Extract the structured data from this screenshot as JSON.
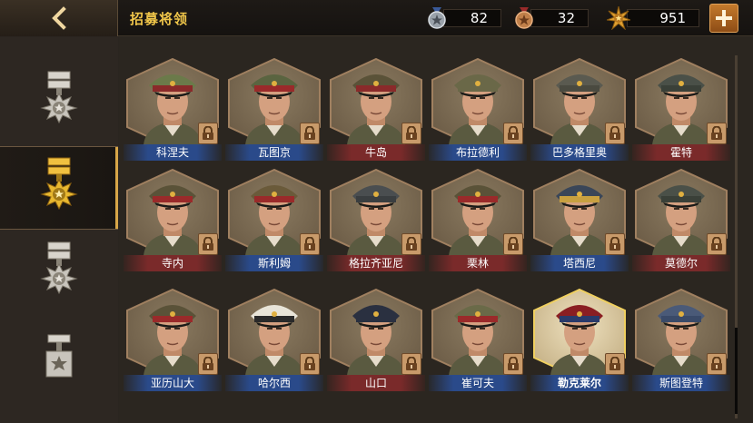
{
  "header": {
    "title": "招募将领",
    "resources": [
      {
        "icon": "silver-medal-icon",
        "value": "82"
      },
      {
        "icon": "bronze-medal-icon",
        "value": "32"
      },
      {
        "icon": "gold-star-badge-icon",
        "value": "951"
      }
    ]
  },
  "sidebar": {
    "tabs": [
      {
        "icon": "rank-1-insignia-icon",
        "active": false
      },
      {
        "icon": "rank-2-insignia-icon",
        "active": true
      },
      {
        "icon": "rank-3-insignia-icon",
        "active": false
      },
      {
        "icon": "rank-4-insignia-icon",
        "active": false
      }
    ]
  },
  "generals": [
    {
      "name": "科涅夫",
      "faction": "blue",
      "cap": "#6b7a4a",
      "band": "#8a2a2a"
    },
    {
      "name": "瓦图京",
      "faction": "blue",
      "cap": "#5a6440",
      "band": "#9a2a2a"
    },
    {
      "name": "牛岛",
      "faction": "red",
      "cap": "#5a5238",
      "band": "#8a2a2a"
    },
    {
      "name": "布拉德利",
      "faction": "blue",
      "cap": "#6a6848",
      "band": "#6a6848"
    },
    {
      "name": "巴多格里奥",
      "faction": "blue",
      "cap": "#5a5a50",
      "band": "#4a4a40"
    },
    {
      "name": "霍特",
      "faction": "red",
      "cap": "#4a5048",
      "band": "#3a4038"
    },
    {
      "name": "寺内",
      "faction": "red",
      "cap": "#5a5238",
      "band": "#9a2a2a"
    },
    {
      "name": "斯利姆",
      "faction": "blue",
      "cap": "#6a5a3a",
      "band": "#9a2a2a"
    },
    {
      "name": "格拉齐亚尼",
      "faction": "red",
      "cap": "#4a4e50",
      "band": "#3a3e40"
    },
    {
      "name": "栗林",
      "faction": "red",
      "cap": "#5a5238",
      "band": "#9a2a2a"
    },
    {
      "name": "塔西尼",
      "faction": "blue",
      "cap": "#3a4658",
      "band": "#c8a040"
    },
    {
      "name": "莫德尔",
      "faction": "red",
      "cap": "#4a5048",
      "band": "#3a4038"
    },
    {
      "name": "亚历山大",
      "faction": "blue",
      "cap": "#5a5238",
      "band": "#9a2a2a"
    },
    {
      "name": "哈尔西",
      "faction": "blue",
      "cap": "#e8e4d8",
      "band": "#2a2a2a"
    },
    {
      "name": "山口",
      "faction": "red",
      "cap": "#2a3040",
      "band": "#2a3040"
    },
    {
      "name": "崔可夫",
      "faction": "blue",
      "cap": "#6a6a48",
      "band": "#9a2a2a"
    },
    {
      "name": "勒克莱尔",
      "faction": "blue",
      "cap": "#8a1e22",
      "band": "#2a3a6a"
    },
    {
      "name": "斯图登特",
      "faction": "blue",
      "cap": "#4a5a78",
      "band": "#3a4a68"
    }
  ],
  "selected_index": 16,
  "colors": {
    "accent": "#f0c64a",
    "blue_banner": "#2a4a8a",
    "red_banner": "#7a2a2a"
  }
}
